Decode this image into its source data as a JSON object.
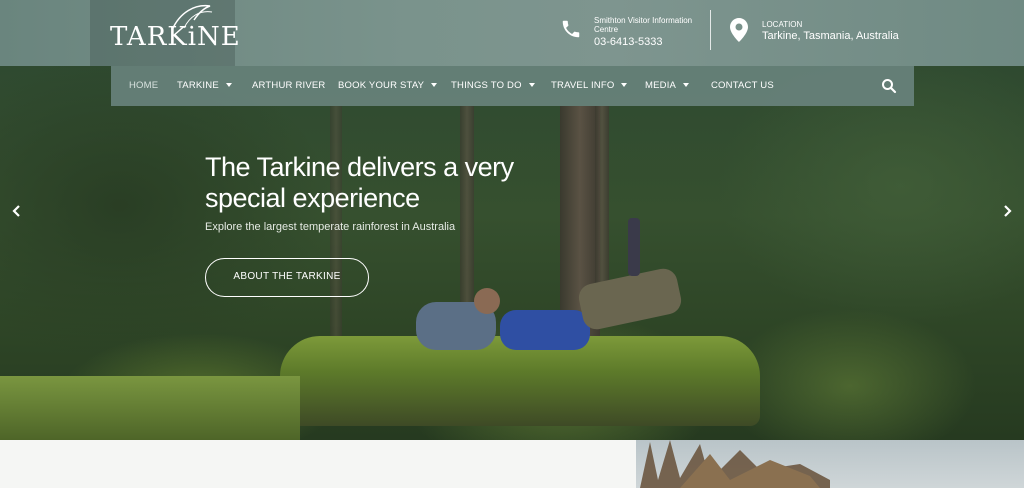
{
  "header": {
    "logo_text": "TARKiNE",
    "phone": {
      "label": "Smithton Visitor Information Centre",
      "value": "03-6413-5333",
      "icon": "phone-icon"
    },
    "location": {
      "label": "LOCATION",
      "value": "Tarkine, Tasmania, Australia",
      "icon": "location-pin-icon"
    }
  },
  "nav": {
    "items": [
      {
        "label": "HOME",
        "dropdown": false,
        "active": true
      },
      {
        "label": "TARKINE",
        "dropdown": true
      },
      {
        "label": "ARTHUR RIVER",
        "dropdown": false
      },
      {
        "label": "BOOK YOUR STAY",
        "dropdown": true
      },
      {
        "label": "THINGS TO DO",
        "dropdown": true
      },
      {
        "label": "TRAVEL INFO",
        "dropdown": true
      },
      {
        "label": "MEDIA",
        "dropdown": true
      },
      {
        "label": "CONTACT US",
        "dropdown": false
      }
    ],
    "search_icon": "search-icon"
  },
  "hero": {
    "title": "The Tarkine delivers a very special experience",
    "subtitle": "Explore the largest temperate rainforest in Australia",
    "button_label": "ABOUT THE TARKINE",
    "prev_icon": "chevron-left-icon",
    "next_icon": "chevron-right-icon"
  },
  "colors": {
    "nav_bg": "#68827c",
    "header_bg": "#7a938c",
    "text": "#ffffff"
  }
}
